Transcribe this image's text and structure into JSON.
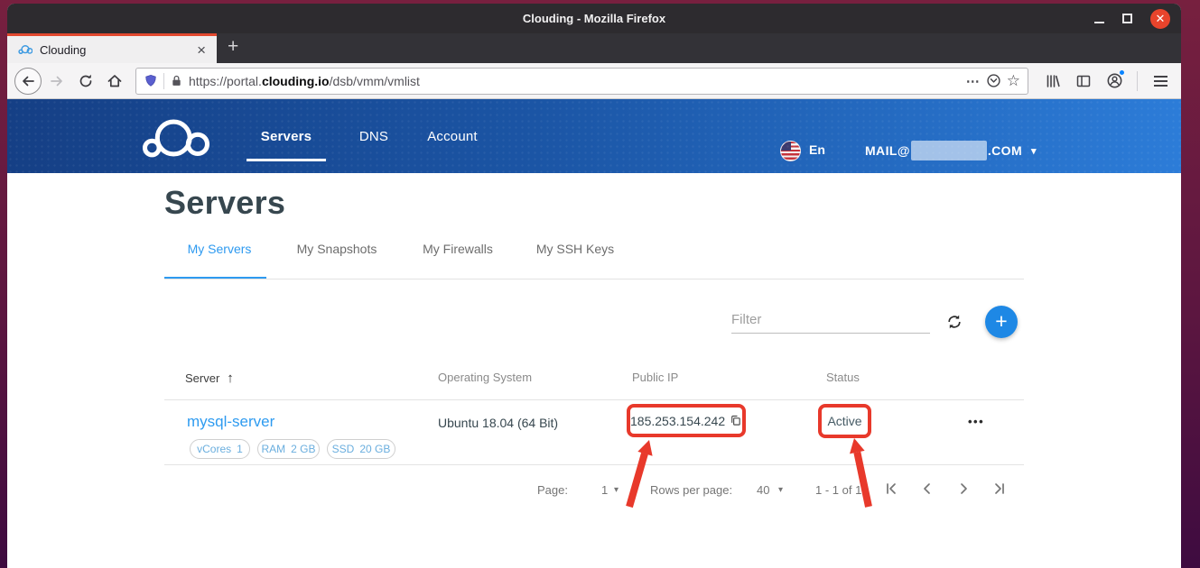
{
  "colors": {
    "accent_blue": "#2e9af0",
    "fab_blue": "#1e88e5",
    "navbar_gradient_left": "#153f85",
    "navbar_gradient_right": "#2c7cd8",
    "annotation_red": "#e8392b",
    "tab_accent_orange": "#e2492f",
    "status_text": "#455a64"
  },
  "titlebar": {
    "title": "Clouding - Mozilla Firefox"
  },
  "browser_tab": {
    "title": "Clouding"
  },
  "icons": {
    "tab_close": "×",
    "new_tab": "+",
    "page_actions": "⋯",
    "star": "☆",
    "sort_asc": "↑",
    "caret_down": "▾",
    "dots_menu": "•••",
    "fab_plus": "+"
  },
  "toolbar": {
    "url_scheme": "https://portal.",
    "url_domain": "clouding.io",
    "url_path": "/dsb/vmm/vmlist"
  },
  "site_nav": {
    "links": [
      {
        "label": "Servers"
      },
      {
        "label": "DNS"
      },
      {
        "label": "Account"
      }
    ],
    "language": "En",
    "email_prefix": "MAIL@",
    "email_suffix": ".COM"
  },
  "page": {
    "title": "Servers",
    "tabs": [
      {
        "label": "My Servers"
      },
      {
        "label": "My Snapshots"
      },
      {
        "label": "My Firewalls"
      },
      {
        "label": "My SSH Keys"
      }
    ],
    "filter_placeholder": "Filter",
    "table": {
      "headers": {
        "server": "Server",
        "os": "Operating System",
        "ip": "Public IP",
        "status": "Status"
      },
      "row": {
        "name": "mysql-server",
        "os": "Ubuntu 18.04 (64 Bit)",
        "ip": "185.253.154.242",
        "status": "Active",
        "chips": [
          {
            "label": "vCores",
            "value": "1"
          },
          {
            "label": "RAM",
            "value": "2 GB"
          },
          {
            "label": "SSD",
            "value": "20 GB"
          }
        ]
      }
    },
    "pagination": {
      "page_label": "Page:",
      "page_value": "1",
      "rows_label": "Rows per page:",
      "rows_value": "40",
      "range": "1 - 1 of 1"
    }
  }
}
